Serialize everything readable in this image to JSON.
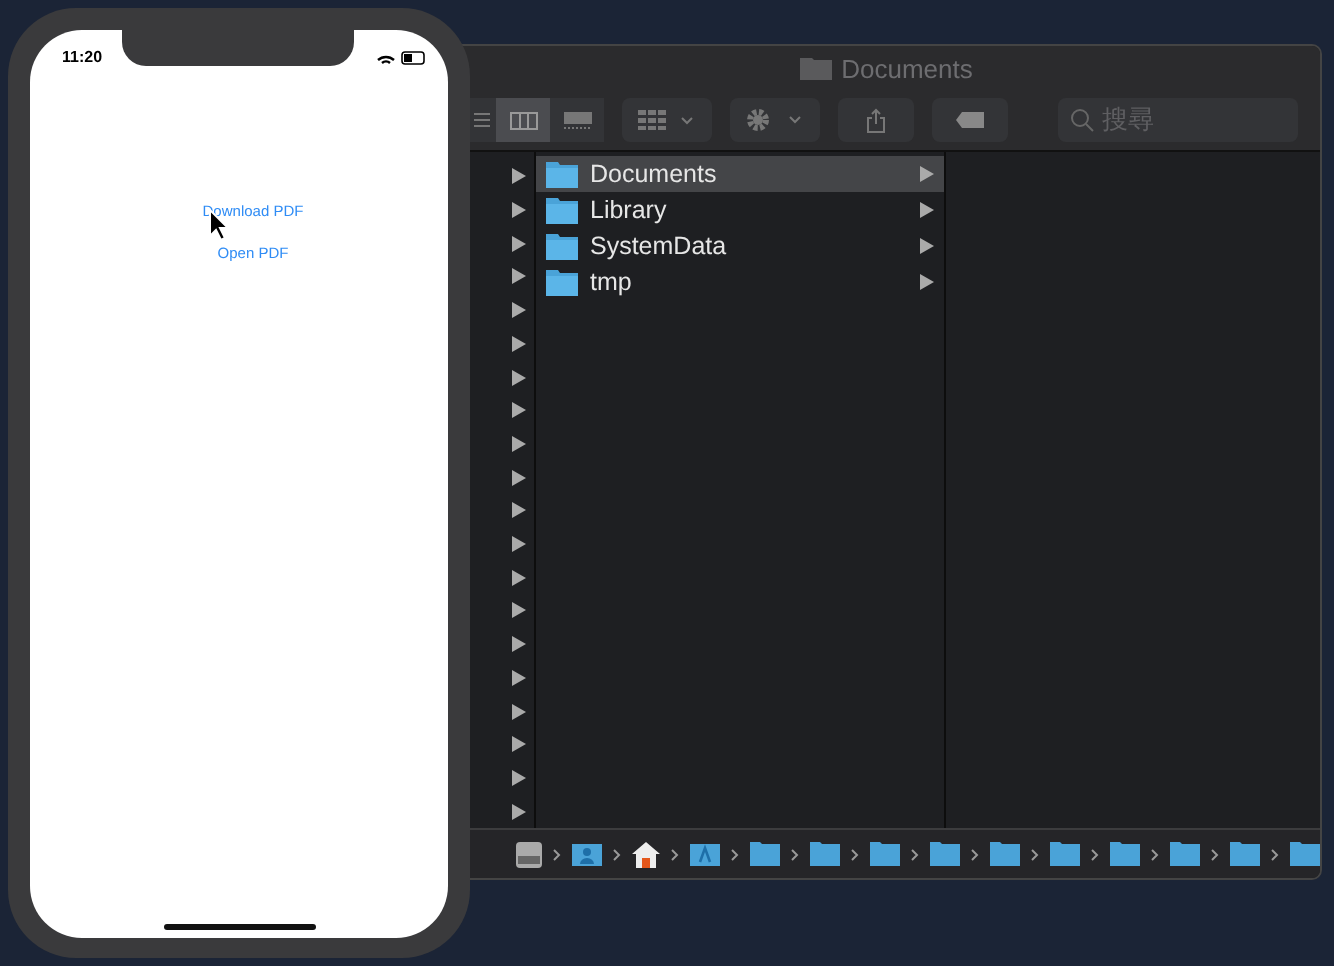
{
  "phone": {
    "time": "11:20",
    "buttons": [
      "Download PDF",
      "Open PDF"
    ]
  },
  "finder": {
    "title": "Documents",
    "view_modes": [
      {
        "kind": "list",
        "selected": false
      },
      {
        "kind": "columns",
        "selected": true
      },
      {
        "kind": "gallery",
        "selected": false
      }
    ],
    "search": {
      "placeholder": "搜尋"
    },
    "folders": [
      {
        "name": "Documents",
        "selected": true
      },
      {
        "name": "Library",
        "selected": false
      },
      {
        "name": "SystemData",
        "selected": false
      },
      {
        "name": "tmp",
        "selected": false
      }
    ],
    "path": [
      {
        "kind": "disk"
      },
      {
        "kind": "user"
      },
      {
        "kind": "home"
      },
      {
        "kind": "apps"
      },
      {
        "kind": "folder"
      },
      {
        "kind": "folder"
      },
      {
        "kind": "folder"
      },
      {
        "kind": "folder"
      },
      {
        "kind": "folder"
      },
      {
        "kind": "folder"
      },
      {
        "kind": "folder"
      },
      {
        "kind": "folder"
      },
      {
        "kind": "folder"
      },
      {
        "kind": "folder"
      }
    ]
  }
}
